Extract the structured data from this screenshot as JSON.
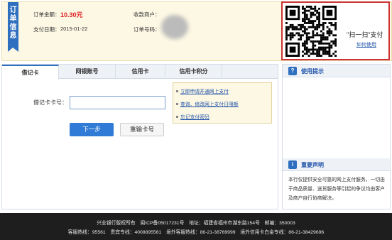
{
  "order": {
    "ribbon": "订单信息",
    "amount_label": "订单金额：",
    "amount_value": "10.30元",
    "merchant_label": "收款商户：",
    "date_label": "支付日期：",
    "date_value": "2015-01-22",
    "orderno_label": "订单号码："
  },
  "qr": {
    "scan_text": "\"扫一扫\"支付",
    "howto": "如何使用"
  },
  "tabs": [
    "借记卡",
    "网银账号",
    "信用卡",
    "信用卡积分"
  ],
  "form": {
    "card_label": "借记卡卡号：",
    "card_value": "",
    "next": "下一步",
    "reenter": "重输卡号"
  },
  "tips": [
    "立即申请开通网上支付",
    "查询、修改网上支付日限额",
    "忘记支付密码"
  ],
  "side": {
    "tips_title": "使用提示",
    "statement_title": "重要声明",
    "statement_text": "本行仅提供安全可靠的网上支付服务，一切由于商品质量、送货服务等引起的争议均由客户及商户自行协商解决。"
  },
  "footer": {
    "line1": "兴业银行版权所有　闽ICP备05017231号　地址：福建省福州市湖东路154号　邮编：350003",
    "line2": "客服热线：95561　贵宾专线：4008895561　境外客服热线：86-21-38769999　境外信用卡白金专线：86-21-38429696"
  },
  "colors": {
    "accent": "#2f6fbf",
    "amount": "#dd2222",
    "panel_bg": "#fdf8e4",
    "footer_bg": "#1e1e1e",
    "qr_border": "#cc3333"
  }
}
